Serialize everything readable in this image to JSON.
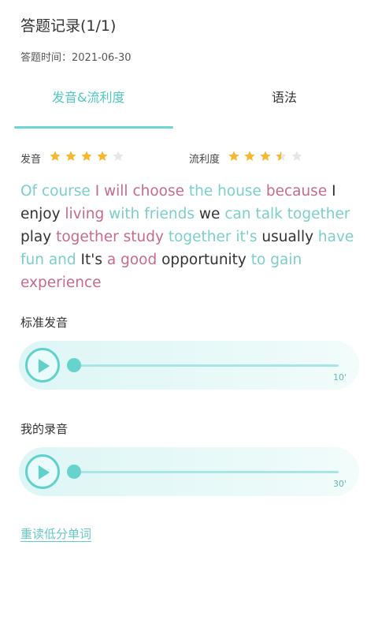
{
  "header": {
    "title": "答题记录(1/1)"
  },
  "answer_time": {
    "label": "答题时间：",
    "value": "2021-06-30"
  },
  "tabs": [
    {
      "label": "发音&流利度",
      "active": true
    },
    {
      "label": "语法",
      "active": false
    }
  ],
  "ratings": {
    "pronunciation": {
      "label": "发音",
      "stars": 4,
      "max": 5
    },
    "fluency": {
      "label": "流利度",
      "stars": 3.5,
      "max": 5
    }
  },
  "sentence": {
    "words": [
      {
        "text": "Of course",
        "color": "teal"
      },
      {
        "text": "I will choose",
        "color": "pink"
      },
      {
        "text": "the house",
        "color": "teal"
      },
      {
        "text": "because",
        "color": "pink"
      },
      {
        "text": "I enjoy",
        "color": "dark"
      },
      {
        "text": "living",
        "color": "pink"
      },
      {
        "text": "with friends",
        "color": "teal"
      },
      {
        "text": "we",
        "color": "dark"
      },
      {
        "text": "can talk together",
        "color": "teal"
      },
      {
        "text": "play",
        "color": "dark"
      },
      {
        "text": "together study",
        "color": "pink"
      },
      {
        "text": "together it's",
        "color": "teal"
      },
      {
        "text": "usually",
        "color": "dark"
      },
      {
        "text": "have fun and",
        "color": "teal"
      },
      {
        "text": "It's",
        "color": "dark"
      },
      {
        "text": "a good",
        "color": "pink"
      },
      {
        "text": "opportunity",
        "color": "dark"
      },
      {
        "text": "to gain",
        "color": "teal"
      },
      {
        "text": "experience",
        "color": "pink"
      }
    ]
  },
  "standard_audio": {
    "label": "标准发音",
    "duration": "10'",
    "progress": 0
  },
  "my_recording": {
    "label": "我的录音",
    "duration": "30'",
    "progress": 0
  },
  "reread_link": {
    "label": "重读低分单词"
  },
  "colors": {
    "accent": "#5fd0ca",
    "teal_word": "#7bcfcb",
    "pink_word": "#c76b8c",
    "star": "#f5b82e"
  }
}
